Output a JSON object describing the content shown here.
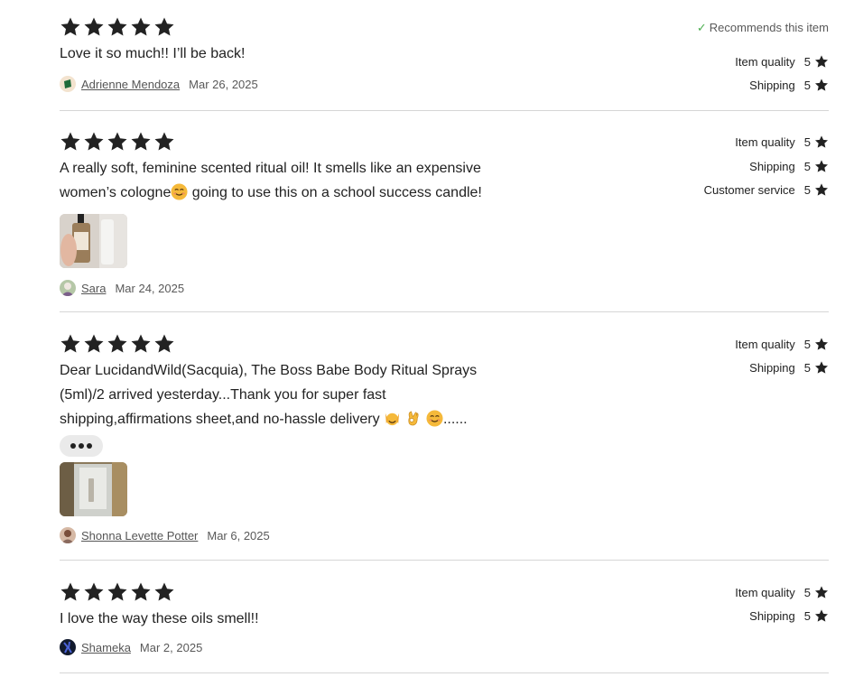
{
  "reviews": [
    {
      "stars": 5,
      "text": "Love it so much!! I’ll be back!",
      "author": "Adrienne Mendoza",
      "date": "Mar 26, 2025",
      "recommends": "Recommends this item",
      "ratings": [
        {
          "label": "Item quality",
          "value": "5"
        },
        {
          "label": "Shipping",
          "value": "5"
        }
      ]
    },
    {
      "stars": 5,
      "text_line1": "A really soft, feminine scented ritual oil! It smells like an expensive",
      "text_line2a": "women’s cologne",
      "text_line2b": " going to use this on a school success candle!",
      "author": "Sara",
      "date": "Mar 24, 2025",
      "ratings": [
        {
          "label": "Item quality",
          "value": "5"
        },
        {
          "label": "Shipping",
          "value": "5"
        },
        {
          "label": "Customer service",
          "value": "5"
        }
      ]
    },
    {
      "stars": 5,
      "text_line1": "Dear LucidandWild(Sacquia), The Boss Babe Body Ritual Sprays",
      "text_line2": "(5ml)/2 arrived yesterday...Thank you for super fast",
      "text_line3": "shipping,affirmations sheet,and no-hassle delivery",
      "text_line3_end": "......",
      "author": "Shonna Levette Potter",
      "date": "Mar 6, 2025",
      "ratings": [
        {
          "label": "Item quality",
          "value": "5"
        },
        {
          "label": "Shipping",
          "value": "5"
        }
      ]
    },
    {
      "stars": 5,
      "text": "I love the way these oils smell!!",
      "author": "Shameka",
      "date": "Mar 2, 2025",
      "ratings": [
        {
          "label": "Item quality",
          "value": "5"
        },
        {
          "label": "Shipping",
          "value": "5"
        }
      ]
    }
  ],
  "colors": {
    "star": "#222222",
    "divider": "#d6d6d6",
    "check": "#4caf50"
  }
}
